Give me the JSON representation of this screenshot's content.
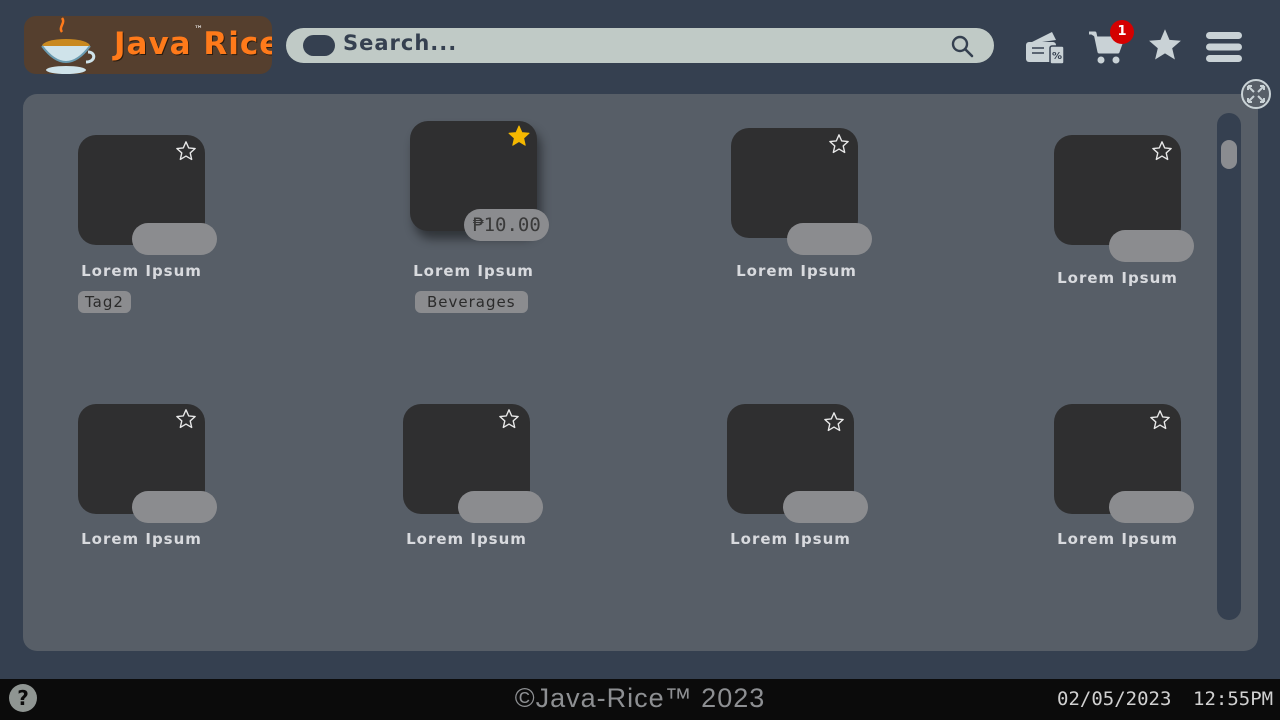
{
  "header": {
    "logo": {
      "text": "Java Rice",
      "trademark": "™"
    },
    "search": {
      "placeholder": "Search..."
    },
    "icons": [
      "vouchers-icon",
      "cart-icon",
      "favorites-star-icon",
      "menu-icon"
    ],
    "cart_count": "1"
  },
  "products": [
    {
      "name": "Lorem Ipsum",
      "tag": "Tag2",
      "price": "",
      "favorited": false
    },
    {
      "name": "Lorem Ipsum",
      "tag": "Beverages",
      "price": "₱10.00",
      "favorited": true
    },
    {
      "name": "Lorem Ipsum",
      "tag": "",
      "price": "",
      "favorited": false
    },
    {
      "name": "Lorem Ipsum",
      "tag": "",
      "price": "",
      "favorited": false
    },
    {
      "name": "Lorem Ipsum",
      "tag": "",
      "price": "",
      "favorited": false
    },
    {
      "name": "Lorem Ipsum",
      "tag": "",
      "price": "",
      "favorited": false
    },
    {
      "name": "Lorem Ipsum",
      "tag": "",
      "price": "",
      "favorited": false
    },
    {
      "name": "Lorem Ipsum",
      "tag": "",
      "price": "",
      "favorited": false
    }
  ],
  "footer": {
    "help": "?",
    "copyright": "©Java-Rice™ 2023",
    "date": "02/05/2023",
    "time": "12:55PM"
  },
  "colors": {
    "background": "#354050",
    "panel": "#575e67",
    "tile": "#2f2f30",
    "accent_star": "#f5b800",
    "badge": "#d40000",
    "logo_text": "#ff7a1a"
  }
}
